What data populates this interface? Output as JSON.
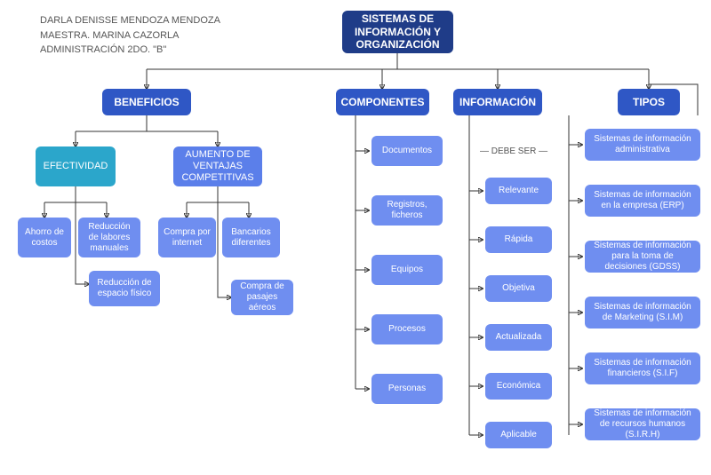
{
  "meta": {
    "line1": "DARLA DENISSE MENDOZA MENDOZA",
    "line2": "MAESTRA. MARINA CAZORLA",
    "line3": "ADMINISTRACIÓN 2DO. \"B\""
  },
  "root": "SISTEMAS DE INFORMACIÓN Y ORGANIZACIÓN",
  "sections": {
    "beneficios": "BENEFICIOS",
    "componentes": "COMPONENTES",
    "informacion": "INFORMACIÓN",
    "tipos": "TIPOS"
  },
  "beneficios": {
    "efectividad": "EFECTIVIDAD",
    "ventajas": "AUMENTO DE VENTAJAS COMPETITIVAS",
    "efectividad_children": {
      "ahorro": "Ahorro de costos",
      "reduccion_labores": "Reducción de labores manuales",
      "reduccion_espacio": "Reducción de espacio físico"
    },
    "ventajas_children": {
      "compra_internet": "Compra por internet",
      "bancarios": "Bancarios diferentes",
      "compra_pasajes": "Compra de pasajes aéreos"
    }
  },
  "componentes": {
    "items": [
      "Documentos",
      "Registros, ficheros",
      "Equipos",
      "Procesos",
      "Personas"
    ]
  },
  "informacion": {
    "subtitle": "DEBE SER",
    "items": [
      "Relevante",
      "Rápida",
      "Objetiva",
      "Actualizada",
      "Económica",
      "Aplicable"
    ]
  },
  "tipos": {
    "items": [
      "Sistemas de información administrativa",
      "Sistemas de información en la empresa (ERP)",
      "Sistemas de información para la toma de decisiones (GDSS)",
      "Sistemas de información de Marketing (S.I.M)",
      "Sistemas de información financieros (S.I.F)",
      "Sistemas de información de recursos humanos (S.I.R.H)"
    ]
  }
}
